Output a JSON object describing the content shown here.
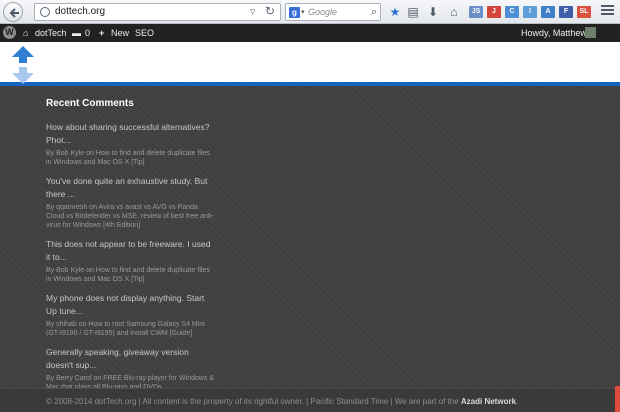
{
  "browser": {
    "url": "dottech.org",
    "search_placeholder": "Google",
    "extensions": [
      {
        "label": "JS",
        "color": "#6b8fc7"
      },
      {
        "label": "J",
        "color": "#d2463c"
      },
      {
        "label": "C",
        "color": "#4f8fd6"
      },
      {
        "label": "I",
        "color": "#5c9fd8"
      },
      {
        "label": "A",
        "color": "#3e7fc9"
      },
      {
        "label": "F",
        "color": "#3f5fa8"
      },
      {
        "label": "SL",
        "color": "#d8523e"
      }
    ]
  },
  "adminbar": {
    "site_name": "dotTech",
    "comments_count": "0",
    "new_label": "New",
    "seo_label": "SEO",
    "greeting": "Howdy, MatthewA"
  },
  "widget": {
    "title": "Recent Comments",
    "comments": [
      {
        "excerpt": "How about sharing successful alternatives? Phot...",
        "meta": "By Bob Kyle on How to find and delete duplicate files in Windows and Mac OS X [Tip]"
      },
      {
        "excerpt": "You've done quite an exhaustive study. But there ...",
        "meta": "By qqamresh on Avira vs avast vs AVG vs Panda Cloud vs Bitdefender vs MSE, review of best free anti-virus for Windows [4th Edition]"
      },
      {
        "excerpt": "This does not appear to be freeware. I used it to...",
        "meta": "By Bob Kyle on How to find and delete duplicate files in Windows and Mac OS X [Tip]"
      },
      {
        "excerpt": "My phone does not display anything. Start Up tune...",
        "meta": "By shihab on How to root Samsung Galaxy S4 Mini (GT-I9190 / GT-I9195) and install CWM [Guide]"
      },
      {
        "excerpt": "Generally speaking, giveaway version doesn't sup...",
        "meta": "By Berry Carol on FREE Blu-ray player for Windows & Mac that plays all Blu-rays and DVDs"
      }
    ]
  },
  "footer": {
    "text": "© 2008-2014 dotTech.org | All content is the property of its rightful owner. | Pacific Standard Time | We are part of the",
    "network": "Azadi Network",
    "end": "."
  },
  "colors": {
    "accent_blue": "#1565c0",
    "background": "#404040"
  }
}
